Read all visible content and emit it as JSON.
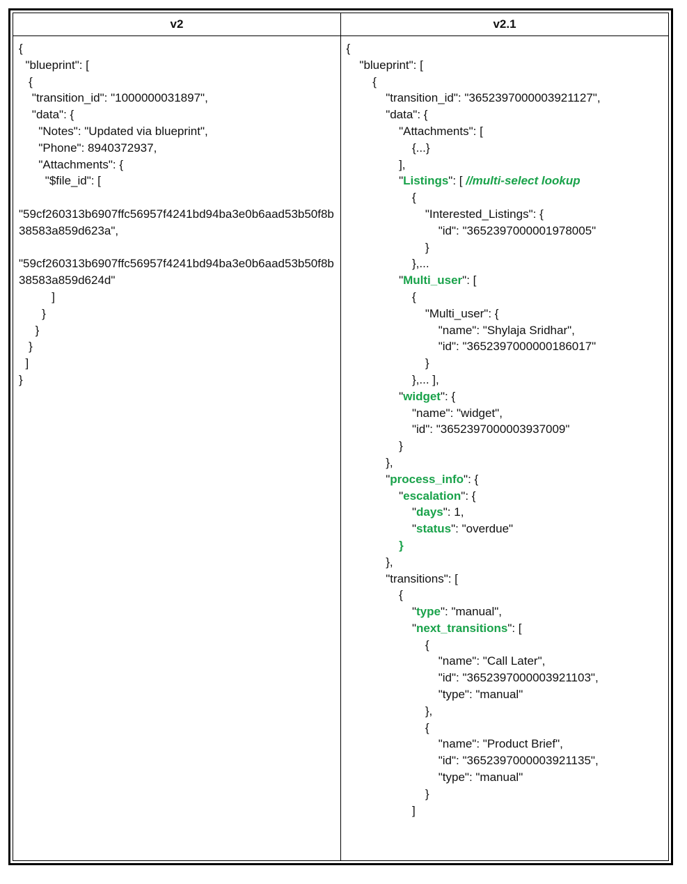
{
  "headers": {
    "left": "v2",
    "right": "v2.1"
  },
  "left": {
    "l1": "{",
    "l2": "  \"blueprint\": [",
    "l3": "   {",
    "l4": "    \"transition_id\": \"1000000031897\",",
    "l5": "    \"data\": {",
    "l6": "      \"Notes\": \"Updated via blueprint\",",
    "l7": "      \"Phone\": 8940372937,",
    "l8": "      \"Attachments\": {",
    "l9": "        \"$file_id\": [",
    "l10": "",
    "l11": "\"59cf260313b6907ffc56957f4241bd94ba3e0b6aad53b50f8b38583a859d623a\",",
    "l12": "",
    "l13": "\"59cf260313b6907ffc56957f4241bd94ba3e0b6aad53b50f8b38583a859d624d\"",
    "l14": "          ]",
    "l15": "       }",
    "l16": "     }",
    "l17": "   }",
    "l18": "  ]",
    "l19": "}"
  },
  "right": {
    "r1": "{",
    "r2": "    \"blueprint\": [",
    "r3": "        {",
    "r4": "            \"transition_id\": \"3652397000003921127\",",
    "r5": "            \"data\": {",
    "r6": "                \"Attachments\": [",
    "r7": "                    {...}",
    "r8": "                ],",
    "r9a": "                \"",
    "r9b": "Listings",
    "r9c": "\": [ ",
    "r9d": "//multi-select lookup",
    "r10": "                    {",
    "r11": "                        \"Interested_Listings\": {",
    "r12": "                            \"id\": \"3652397000001978005\"",
    "r13": "                        }",
    "r14": "                    },...",
    "r15a": "                \"",
    "r15b": "Multi_user",
    "r15c": "\": [",
    "r16": "                    {",
    "r17": "                        \"Multi_user\": {",
    "r18": "                            \"name\": \"Shylaja Sridhar\",",
    "r19": "                            \"id\": \"3652397000000186017\"",
    "r20": "                        }",
    "r21": "                    },... ],",
    "r22a": "                \"",
    "r22b": "widget",
    "r22c": "\": {",
    "r23": "                    \"name\": \"widget\",",
    "r24": "                    \"id\": \"3652397000003937009\"",
    "r25": "                }",
    "r26": "            },",
    "r27a": "            \"",
    "r27b": "process_info",
    "r27c": "\": {",
    "r28a": "                \"",
    "r28b": "escalation",
    "r28c": "\": {",
    "r29a": "                    \"",
    "r29b": "days",
    "r29c": "\": 1,",
    "r30a": "                    \"",
    "r30b": "status",
    "r30c": "\": \"overdue\"",
    "r31": "                }",
    "r32": "            },",
    "r33": "            \"transitions\": [",
    "r34": "                {",
    "r35a": "                    \"",
    "r35b": "type",
    "r35c": "\": \"manual\",",
    "r36a": "                    \"",
    "r36b": "next_transitions",
    "r36c": "\": [",
    "r37": "                        {",
    "r38": "                            \"name\": \"Call Later\",",
    "r39": "                            \"id\": \"3652397000003921103\",",
    "r40": "                            \"type\": \"manual\"",
    "r41": "                        },",
    "r42": "                        {",
    "r43": "                            \"name\": \"Product Brief\",",
    "r44": "                            \"id\": \"3652397000003921135\",",
    "r45": "                            \"type\": \"manual\"",
    "r46": "                        }",
    "r47": "                    ]"
  }
}
